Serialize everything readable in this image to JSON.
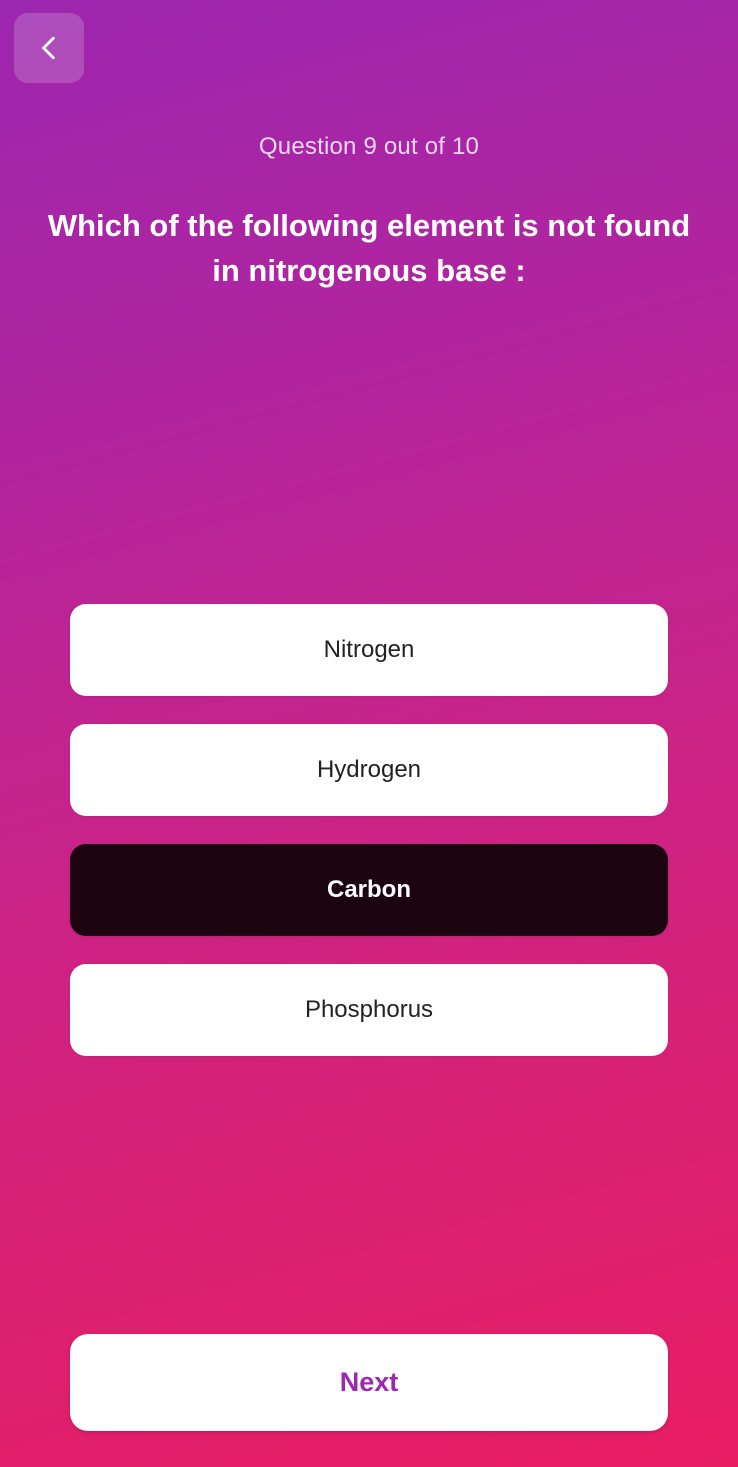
{
  "header": {
    "back_icon": "chevron-left-icon"
  },
  "quiz": {
    "progress_text": "Question 9 out of 10",
    "question": "Which of the following element is not found in nitrogenous base :",
    "options": [
      {
        "label": "Nitrogen",
        "selected": false
      },
      {
        "label": "Hydrogen",
        "selected": false
      },
      {
        "label": "Carbon",
        "selected": true
      },
      {
        "label": "Phosphorus",
        "selected": false
      }
    ]
  },
  "footer": {
    "next_label": "Next"
  },
  "colors": {
    "gradient_start": "#9c27b0",
    "gradient_end": "#e91e63",
    "selected_option_bg": "#1c0410",
    "option_bg": "#ffffff",
    "next_text": "#9c27b0"
  }
}
